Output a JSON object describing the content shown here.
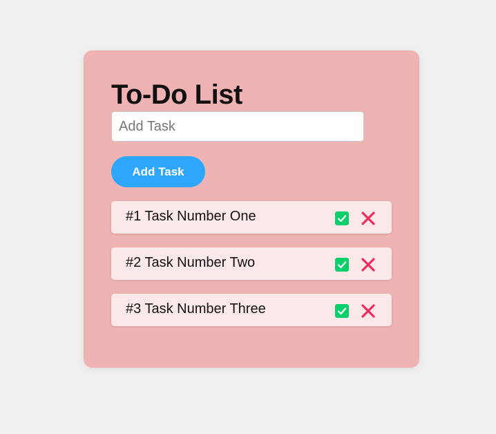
{
  "app": {
    "title": "To-Do List"
  },
  "input": {
    "placeholder": "Add Task",
    "value": ""
  },
  "add_button": {
    "label": "Add Task"
  },
  "tasks": [
    {
      "label": "#1 Task Number One"
    },
    {
      "label": "#2 Task Number Two"
    },
    {
      "label": "#3 Task Number Three"
    }
  ],
  "icons": {
    "complete": "checkmark-icon",
    "delete": "close-icon"
  },
  "colors": {
    "page_background": "#f0f0f0",
    "card_background": "#f0b3b3",
    "task_background": "#fbe9e9",
    "button_blue": "#2ea6fb",
    "check_green": "#0bcf6a",
    "delete_red": "#ee2b5b"
  }
}
